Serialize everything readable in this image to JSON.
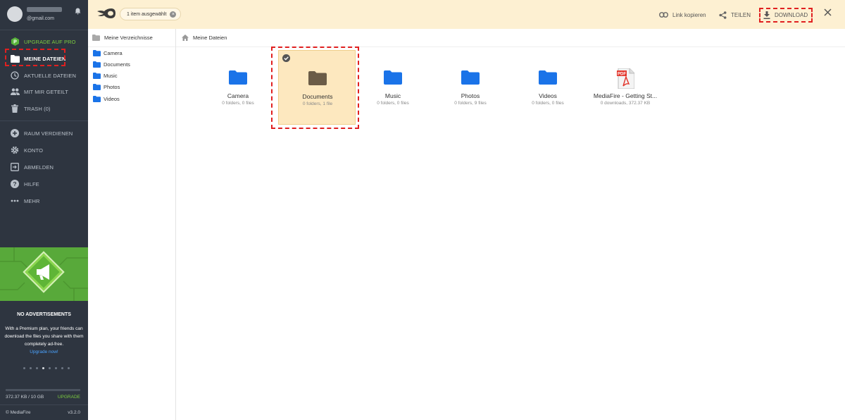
{
  "user": {
    "email": "@gmail.com"
  },
  "sidebar": {
    "upgrade": "UPGRADE AUF PRO",
    "items": [
      {
        "id": "my-files",
        "label": "MEINE DATEIEN"
      },
      {
        "id": "recent",
        "label": "AKTUELLE DATEIEN"
      },
      {
        "id": "shared",
        "label": "MIT MIR GETEILT"
      },
      {
        "id": "trash",
        "label": "TRASH (0)"
      },
      {
        "id": "earn",
        "label": "RAUM VERDIENEN"
      },
      {
        "id": "account",
        "label": "KONTO"
      },
      {
        "id": "logout",
        "label": "ABMELDEN"
      },
      {
        "id": "help",
        "label": "HILFE"
      },
      {
        "id": "more",
        "label": "MEHR"
      }
    ],
    "promo": {
      "title": "NO ADVERTISEMENTS",
      "text": "With a Premium plan, your friends can download the files you share with them completely ad-free.",
      "link": "Upgrade now!",
      "slide_count": 8,
      "active_slide": 4
    },
    "storage": {
      "used": "372.37 KB / 10 GB",
      "upgrade": "UPGRADE",
      "fraction": 0.0
    },
    "copyright": "© MediaFire",
    "version": "v3.2.0"
  },
  "topbar": {
    "selection": "1 item ausgewählt",
    "copy_link": "Link kopieren",
    "share": "TEILEN",
    "download": "DOWNLOAD"
  },
  "tree": {
    "root": "Meine Verzeichnisse",
    "folders": [
      "Camera",
      "Documents",
      "Music",
      "Photos",
      "Videos"
    ]
  },
  "breadcrumb": "Meine Dateien",
  "files": [
    {
      "name": "Camera",
      "meta": "0 folders, 0 files",
      "type": "folder",
      "selected": false
    },
    {
      "name": "Documents",
      "meta": "0 folders, 1 file",
      "type": "folder",
      "selected": true
    },
    {
      "name": "Music",
      "meta": "0 folders, 0 files",
      "type": "folder",
      "selected": false
    },
    {
      "name": "Photos",
      "meta": "0 folders, 9 files",
      "type": "folder",
      "selected": false
    },
    {
      "name": "Videos",
      "meta": "0 folders, 0 files",
      "type": "folder",
      "selected": false
    },
    {
      "name": "MediaFire - Getting St...",
      "meta": "0 downloads, 372.37 KB",
      "type": "pdf",
      "selected": false
    }
  ],
  "colors": {
    "sidebar": "#2e3540",
    "accent_green": "#7ccd3f",
    "folder_blue": "#1a73e8",
    "topbar": "#fdf0d2",
    "selection": "#fde8bf",
    "highlight": "#e02020"
  },
  "icons": {
    "pdf_label": "PDF"
  }
}
